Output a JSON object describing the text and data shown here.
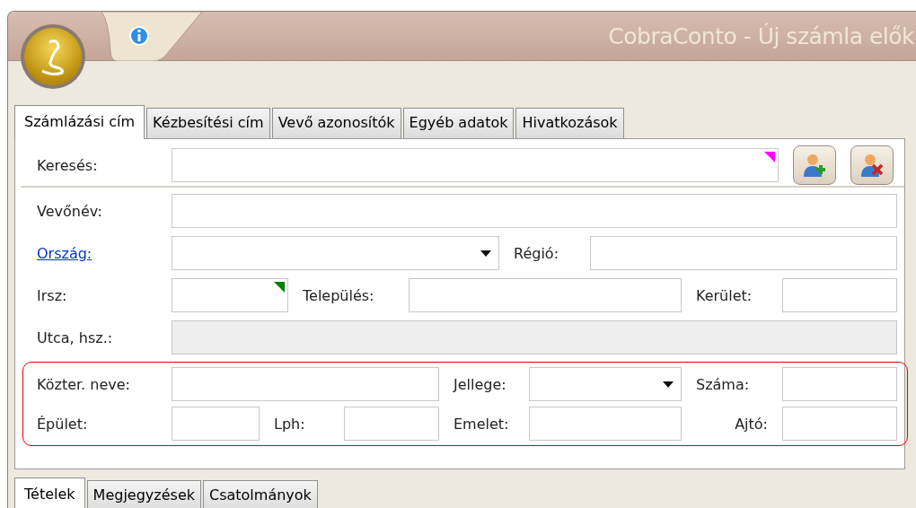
{
  "window": {
    "title": "CobraConto - Új számla elők"
  },
  "top_tabs": [
    {
      "label": "Számlázási cím",
      "selected": true
    },
    {
      "label": "Kézbesítési cím",
      "selected": false
    },
    {
      "label": "Vevő azonosítók",
      "selected": false
    },
    {
      "label": "Egyéb adatok",
      "selected": false
    },
    {
      "label": "Hivatkozások",
      "selected": false
    }
  ],
  "form_rows": [
    {
      "items": [
        {
          "kind": "label",
          "text": "Keresés:"
        },
        {
          "kind": "field",
          "color": "#ff00ff"
        },
        {
          "kind": "add_button"
        },
        {
          "kind": "remove_button"
        }
      ]
    },
    {
      "items": [
        {
          "kind": "label",
          "text": "Vevőnév:"
        },
        {
          "kind": "field"
        }
      ]
    },
    {
      "items": [
        {
          "kind": "link",
          "text": "Ország:"
        },
        {
          "kind": "dropdown"
        },
        {
          "kind": "label",
          "text": "Régió:"
        },
        {
          "kind": "field"
        }
      ]
    },
    {
      "items": [
        {
          "kind": "label",
          "text": "Irsz:"
        },
        {
          "kind": "field",
          "color": "#008000"
        },
        {
          "kind": "label",
          "text": "Település:"
        },
        {
          "kind": "field"
        },
        {
          "kind": "label",
          "text": "Kerület:"
        },
        {
          "kind": "field"
        }
      ]
    },
    {
      "items": [
        {
          "kind": "label",
          "text": "Utca, hsz.:"
        },
        {
          "kind": "field",
          "disabled": true
        }
      ]
    }
  ],
  "highlighted_rows": [
    {
      "items": [
        {
          "kind": "label",
          "text": "Közter. neve:"
        },
        {
          "kind": "field"
        },
        {
          "kind": "label",
          "text": "Jellege:"
        },
        {
          "kind": "dropdown"
        },
        {
          "kind": "label",
          "text": "Száma:"
        },
        {
          "kind": "field"
        }
      ]
    },
    {
      "items": [
        {
          "kind": "label",
          "text": "Épület:"
        },
        {
          "kind": "field"
        },
        {
          "kind": "label",
          "text": "Lph:"
        },
        {
          "kind": "field"
        },
        {
          "kind": "label",
          "text": "Emelet:"
        },
        {
          "kind": "field"
        },
        {
          "kind": "label",
          "text": "Ajtó:"
        },
        {
          "kind": "field"
        }
      ]
    }
  ],
  "bottom_tabs": [
    {
      "label": "Tételek",
      "selected": true
    },
    {
      "label": "Megjegyzések",
      "selected": false
    },
    {
      "label": "Csatolmányok",
      "selected": false
    }
  ]
}
